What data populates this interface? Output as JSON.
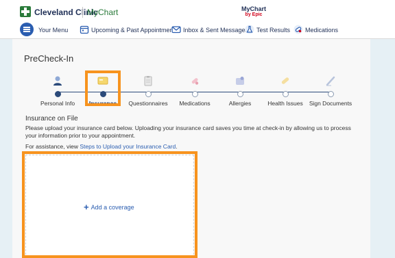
{
  "header": {
    "brand_name": "Cleveland Clinic",
    "brand_product": "MyChart",
    "epic_logo": {
      "line1": "MyChart",
      "line2": "by Epic"
    }
  },
  "nav": {
    "menu_label": "Your Menu",
    "items": [
      {
        "label": "Upcoming & Past Appointments",
        "icon": "calendar-icon"
      },
      {
        "label": "Inbox & Sent Messages",
        "icon": "envelope-icon"
      },
      {
        "label": "Test Results",
        "icon": "flask-icon"
      },
      {
        "label": "Medications",
        "icon": "pills-icon"
      }
    ]
  },
  "page": {
    "title": "PreCheck-In"
  },
  "steps": [
    {
      "label": "Personal Info",
      "icon": "person-icon",
      "state": "done"
    },
    {
      "label": "Insurance",
      "icon": "card-icon",
      "state": "active"
    },
    {
      "label": "Questionnaires",
      "icon": "clipboard-icon",
      "state": "todo"
    },
    {
      "label": "Medications",
      "icon": "pills-icon",
      "state": "todo"
    },
    {
      "label": "Allergies",
      "icon": "allergy-icon",
      "state": "todo"
    },
    {
      "label": "Health Issues",
      "icon": "bandage-icon",
      "state": "todo"
    },
    {
      "label": "Sign Documents",
      "icon": "pen-icon",
      "state": "todo"
    }
  ],
  "insurance": {
    "title": "Insurance on File",
    "description": "Please upload your insurance card below. Uploading your insurance card saves you time at check-in by allowing us to process your information prior to your appointment.",
    "assist_prefix": "For assistance, view ",
    "assist_link": "Steps to Upload your Insurance Card",
    "assist_suffix": ".",
    "add_coverage": "Add a coverage"
  },
  "colors": {
    "accent": "#2a5db0",
    "highlight": "#f7931e",
    "brand_green": "#2a7a3a",
    "navy": "#1f2f56"
  }
}
